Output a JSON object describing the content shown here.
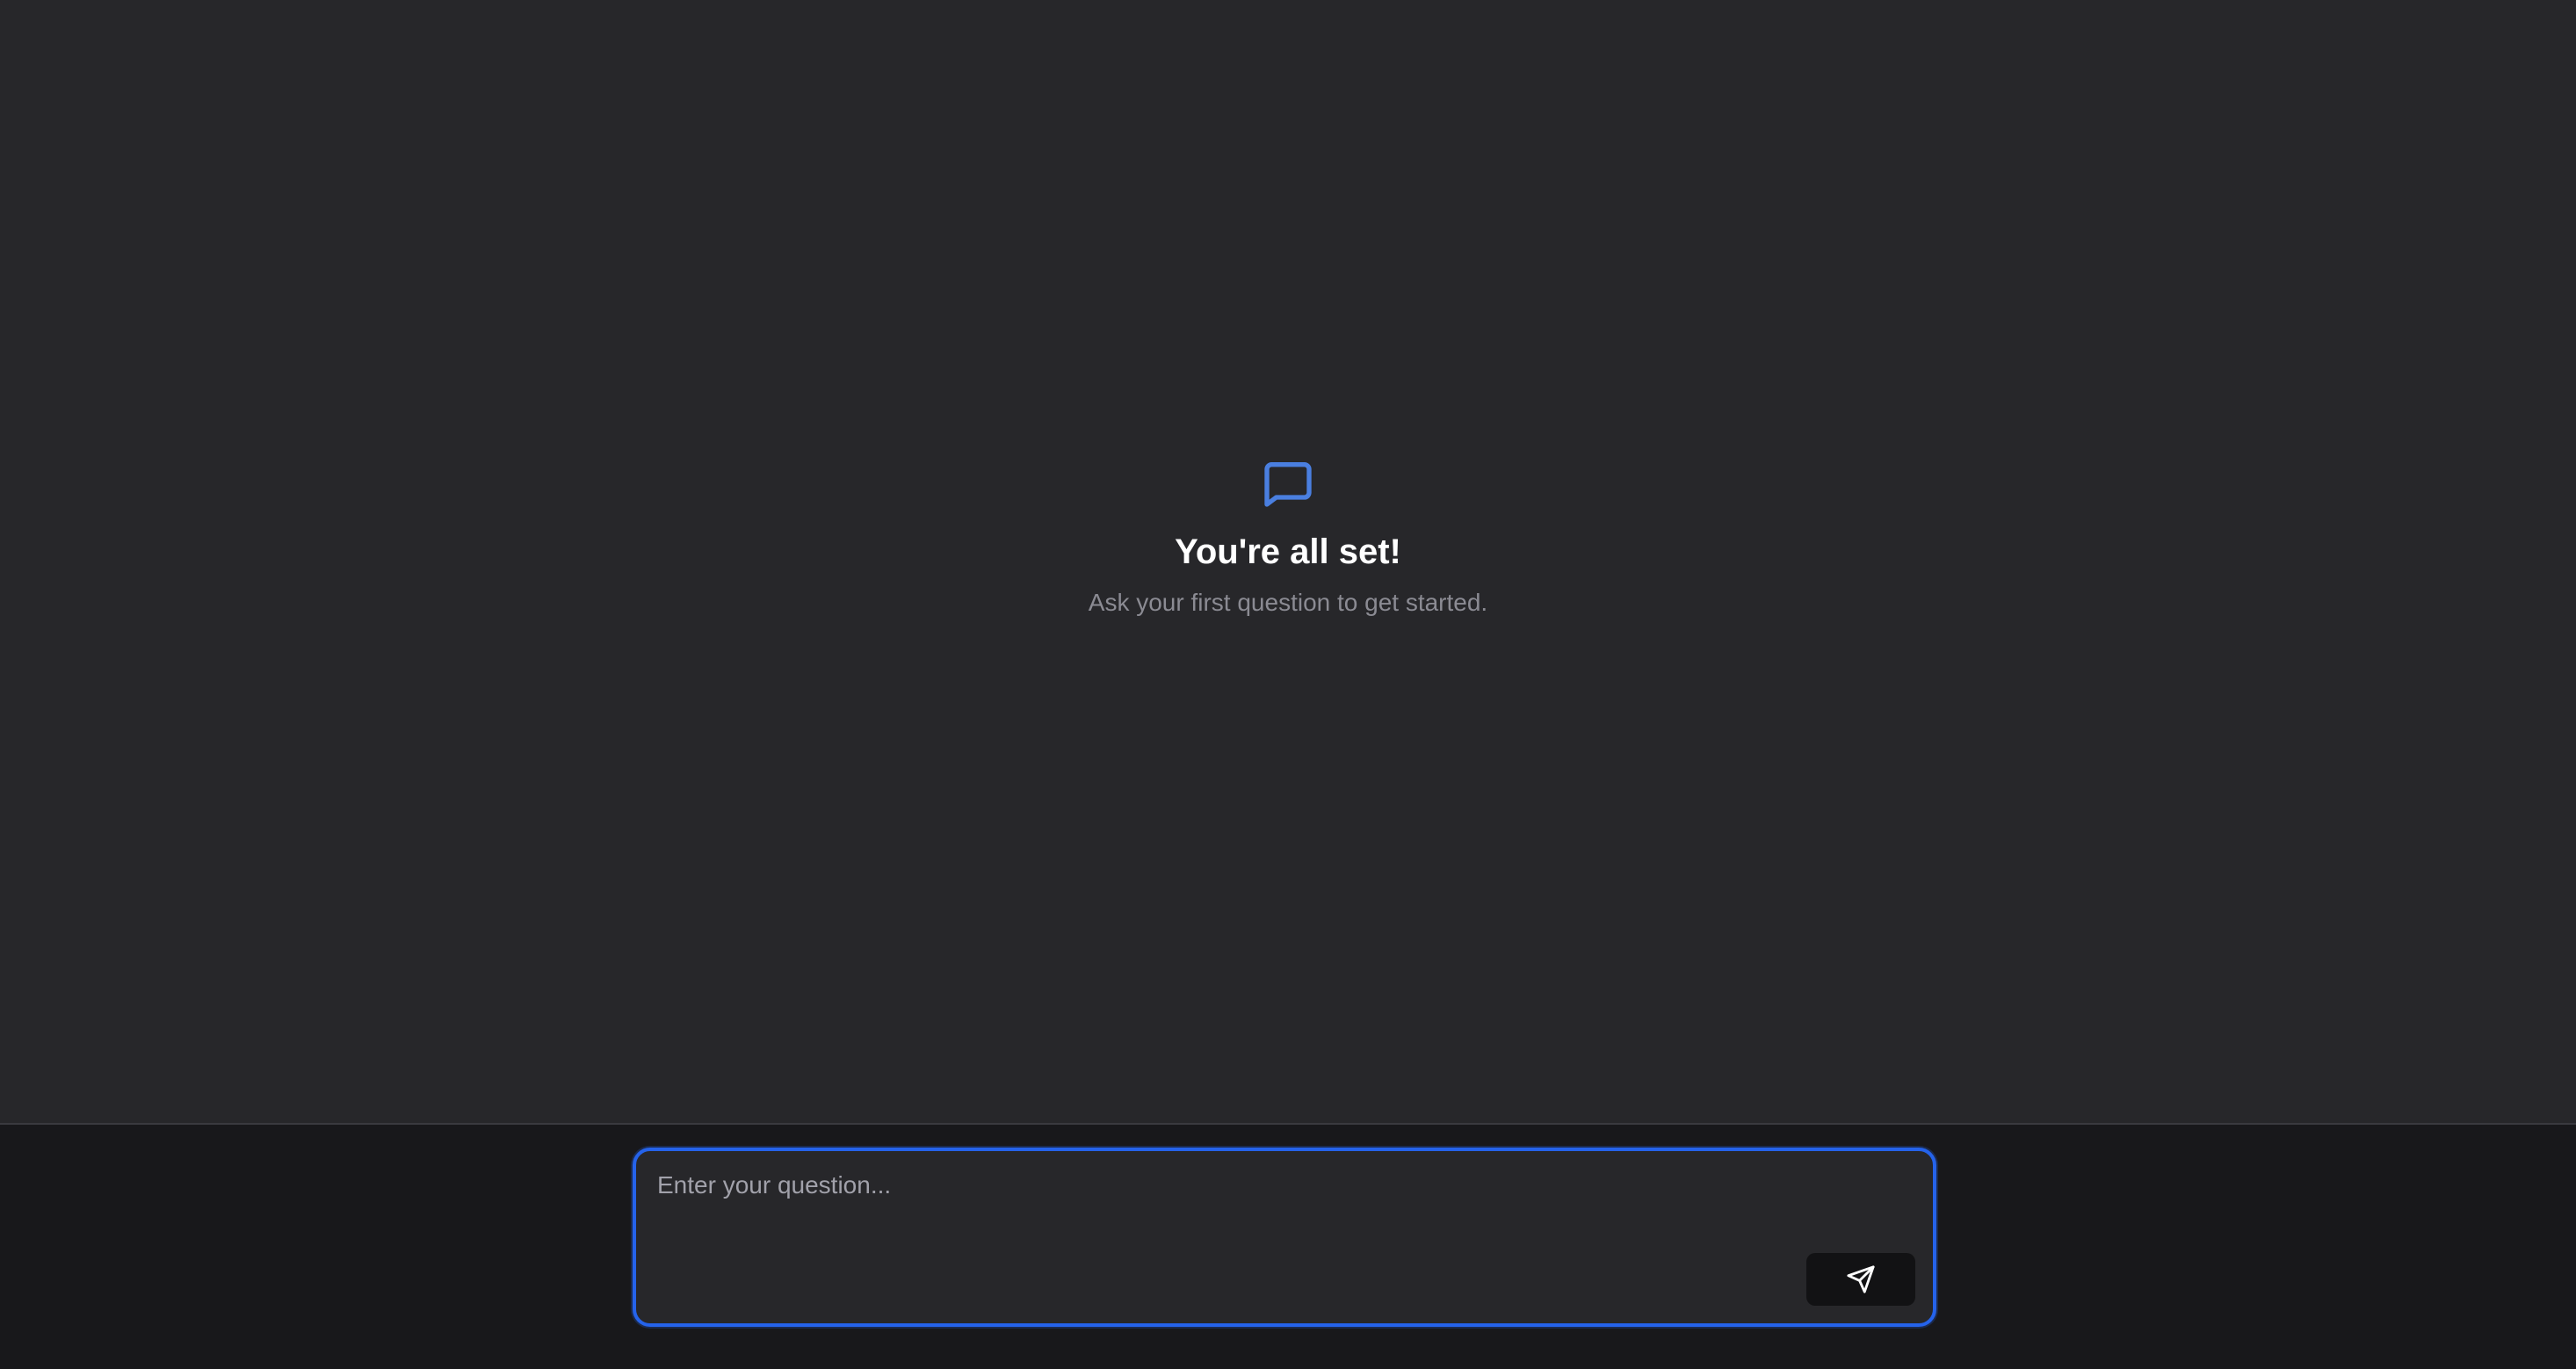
{
  "empty_state": {
    "icon": "chat-bubble-icon",
    "title": "You're all set!",
    "subtitle": "Ask your first question to get started."
  },
  "composer": {
    "placeholder": "Enter your question...",
    "value": "",
    "send_icon": "send-icon"
  },
  "colors": {
    "background": "#27272a",
    "bottom_bar": "#18181b",
    "accent": "#2563eb",
    "icon_blue": "#4a7fe0",
    "title": "#ffffff",
    "subtitle": "#8b8b93",
    "send_button": "#121214"
  }
}
